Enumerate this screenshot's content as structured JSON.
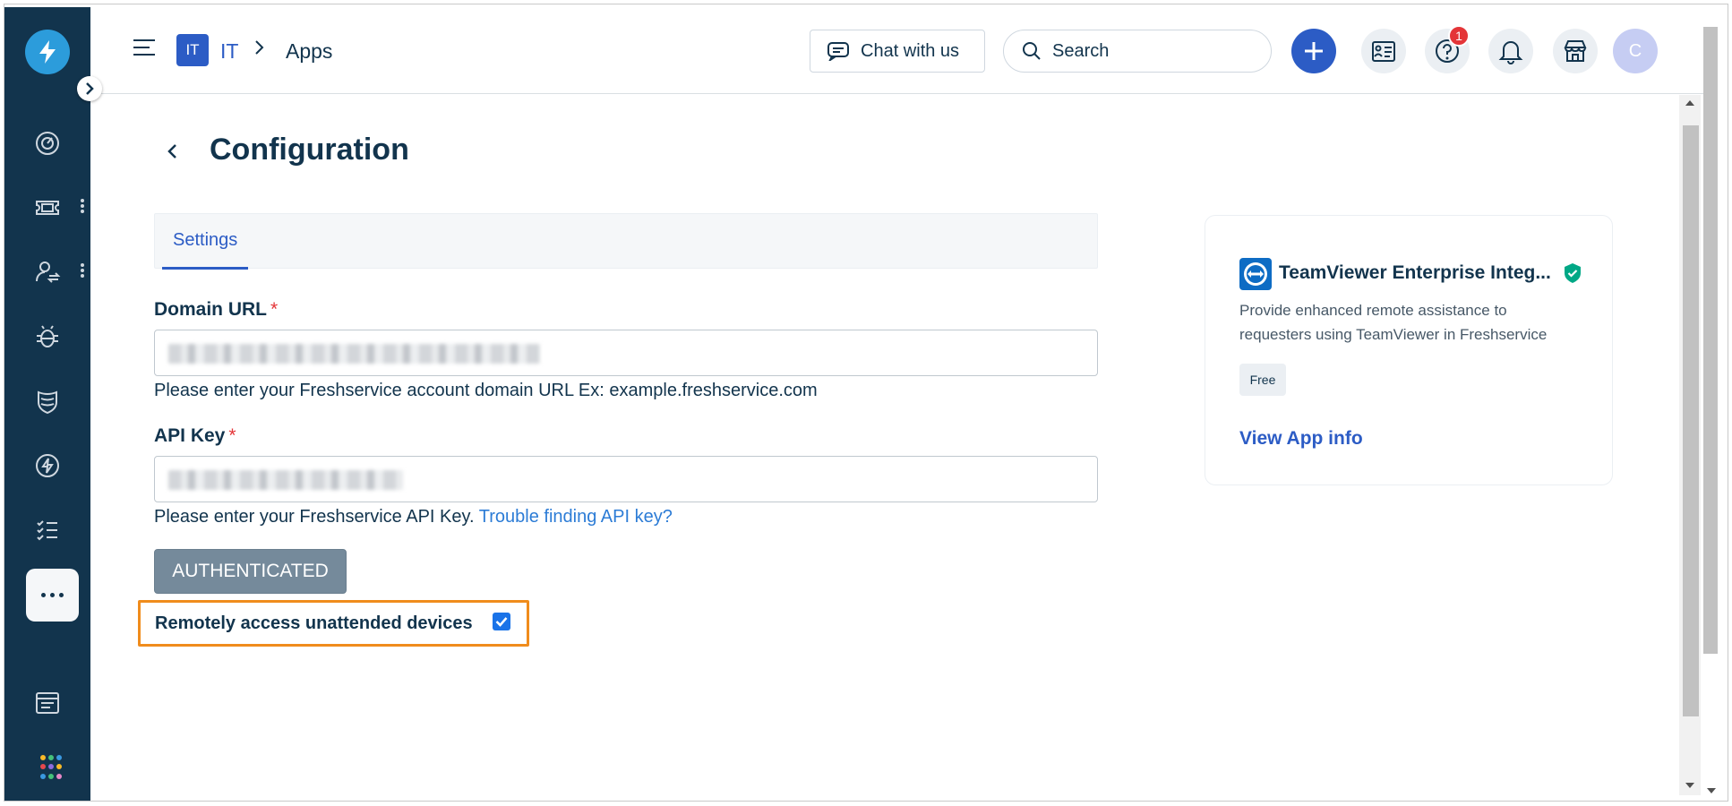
{
  "header": {
    "workspace_badge": "IT",
    "workspace_name": "IT",
    "breadcrumb_separator": ">",
    "breadcrumb_current": "Apps",
    "chat_label": "Chat with us",
    "search_placeholder": "Search",
    "notification_count": "1",
    "avatar_initial": "C"
  },
  "sidebar": {
    "items": [
      "dashboard-icon",
      "tickets-icon",
      "contacts-icon",
      "problems-icon",
      "changes-icon",
      "releases-icon",
      "tasks-icon",
      "more-icon",
      "news-icon",
      "apps-grid-icon"
    ]
  },
  "page": {
    "title": "Configuration",
    "tabs": [
      "Settings"
    ]
  },
  "form": {
    "domain_label": "Domain URL",
    "required_mark": "*",
    "domain_value_redacted": true,
    "domain_hint": "Please enter your Freshservice account domain URL Ex: example.freshservice.com",
    "api_label": "API Key",
    "api_value_redacted": true,
    "api_hint": "Please enter your Freshservice API Key.",
    "api_hint_link": "Trouble finding API key?",
    "auth_button": "AUTHENTICATED",
    "remote_label": "Remotely access unattended devices",
    "remote_checked": true
  },
  "app_card": {
    "name": "TeamViewer Enterprise Integ...",
    "description": "Provide enhanced remote assistance to requesters using TeamViewer in Freshservice",
    "badge": "Free",
    "link": "View App info"
  },
  "colors": {
    "sidebar": "#12344d",
    "accent": "#2c5cc5",
    "highlight": "#f08c1c",
    "verified": "#00a886"
  }
}
